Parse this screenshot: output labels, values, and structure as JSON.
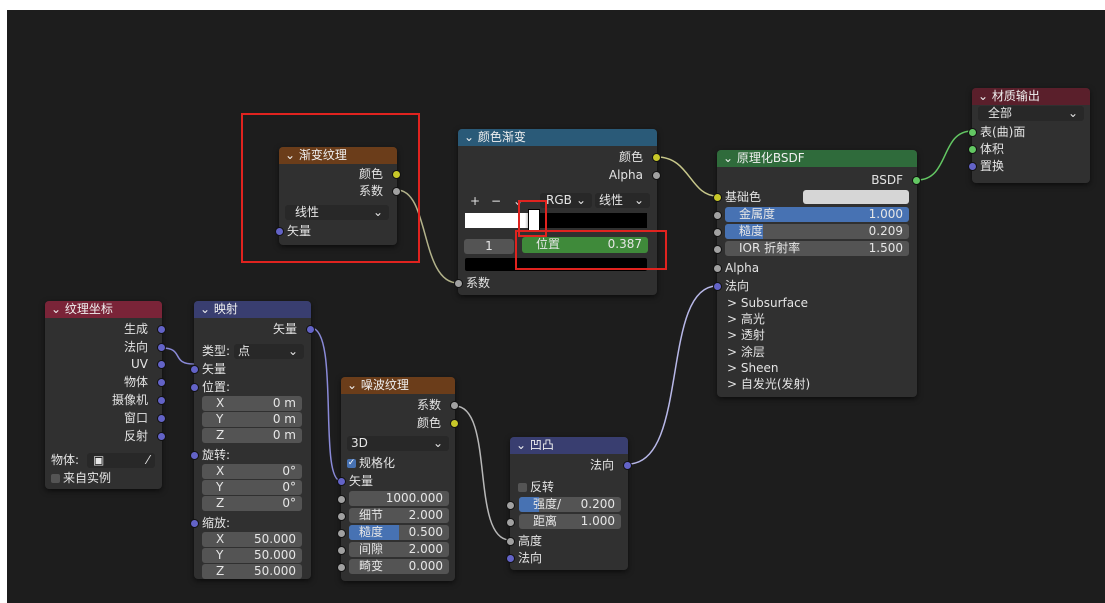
{
  "nodes": {
    "gradient": {
      "title": "渐变纹理",
      "out_color": "颜色",
      "out_fac": "系数",
      "type": "线性",
      "in_vector": "矢量"
    },
    "ramp": {
      "title": "颜色渐变",
      "out_color": "颜色",
      "out_alpha": "Alpha",
      "plus": "+",
      "minus": "−",
      "mode": "RGB",
      "interp": "线性",
      "index": "1",
      "pos_label": "位置",
      "pos_value": "0.387",
      "in_fac": "系数"
    },
    "texcoord": {
      "title": "纹理坐标",
      "outputs": [
        "生成",
        "法向",
        "UV",
        "物体",
        "摄像机",
        "窗口",
        "反射"
      ],
      "object_label": "物体:",
      "from_instancer": "来自实例"
    },
    "mapping": {
      "title": "映射",
      "out_vector": "矢量",
      "type_label": "类型:",
      "type_value": "点",
      "in_vector": "矢量",
      "location": "位置:",
      "rotation": "旋转:",
      "scale": "缩放:",
      "loc": [
        [
          "X",
          "0 m"
        ],
        [
          "Y",
          "0 m"
        ],
        [
          "Z",
          "0 m"
        ]
      ],
      "rot": [
        [
          "X",
          "0°"
        ],
        [
          "Y",
          "0°"
        ],
        [
          "Z",
          "0°"
        ]
      ],
      "scl": [
        [
          "X",
          "50.000"
        ],
        [
          "Y",
          "50.000"
        ],
        [
          "Z",
          "50.000"
        ]
      ]
    },
    "noise": {
      "title": "噪波纹理",
      "out_fac": "系数",
      "out_color": "颜色",
      "dim": "3D",
      "normalize": "规格化",
      "in_vector": "矢量",
      "scale_value": "1000.000",
      "detail_label": "细节",
      "detail_value": "2.000",
      "rough_label": "糙度",
      "rough_value": "0.500",
      "lac_label": "间隙",
      "lac_value": "2.000",
      "distort_label": "畸变",
      "distort_value": "0.000"
    },
    "bump": {
      "title": "凹凸",
      "out_normal": "法向",
      "invert": "反转",
      "strength_label": "强度/",
      "strength_value": "0.200",
      "distance_label": "距离",
      "distance_value": "1.000",
      "in_height": "高度",
      "in_normal": "法向"
    },
    "bsdf": {
      "title": "原理化BSDF",
      "out": "BSDF",
      "base_color": "基础色",
      "metallic_label": "金属度",
      "metallic_value": "1.000",
      "rough_label": "糙度",
      "rough_value": "0.209",
      "ior_label": "IOR 折射率",
      "ior_value": "1.500",
      "alpha": "Alpha",
      "normal": "法向",
      "panels": [
        "> Subsurface",
        "> 高光",
        "> 透射",
        "> 涂层",
        "> Sheen",
        "> 自发光(发射)"
      ]
    },
    "output": {
      "title": "材质输出",
      "target": "全部",
      "surface": "表(曲)面",
      "volume": "体积",
      "displacement": "置换"
    }
  },
  "colors": {
    "highlight_box": "#e0231f",
    "texture_header": "#6b3d1a",
    "vector_header": "#393e70",
    "shader_header": "#2f6b3b"
  }
}
